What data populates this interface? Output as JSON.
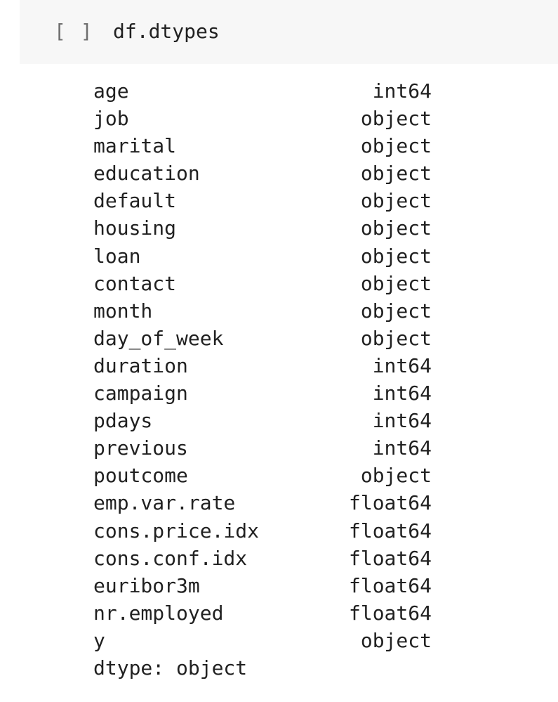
{
  "cell": {
    "prompt": "[ ]",
    "code": "df.dtypes"
  },
  "output": {
    "rows": [
      {
        "name": "age",
        "type": "int64"
      },
      {
        "name": "job",
        "type": "object"
      },
      {
        "name": "marital",
        "type": "object"
      },
      {
        "name": "education",
        "type": "object"
      },
      {
        "name": "default",
        "type": "object"
      },
      {
        "name": "housing",
        "type": "object"
      },
      {
        "name": "loan",
        "type": "object"
      },
      {
        "name": "contact",
        "type": "object"
      },
      {
        "name": "month",
        "type": "object"
      },
      {
        "name": "day_of_week",
        "type": "object"
      },
      {
        "name": "duration",
        "type": "int64"
      },
      {
        "name": "campaign",
        "type": "int64"
      },
      {
        "name": "pdays",
        "type": "int64"
      },
      {
        "name": "previous",
        "type": "int64"
      },
      {
        "name": "poutcome",
        "type": "object"
      },
      {
        "name": "emp.var.rate",
        "type": "float64"
      },
      {
        "name": "cons.price.idx",
        "type": "float64"
      },
      {
        "name": "cons.conf.idx",
        "type": "float64"
      },
      {
        "name": "euribor3m",
        "type": "float64"
      },
      {
        "name": "nr.employed",
        "type": "float64"
      },
      {
        "name": "y",
        "type": "object"
      }
    ],
    "footer": "dtype: object"
  }
}
